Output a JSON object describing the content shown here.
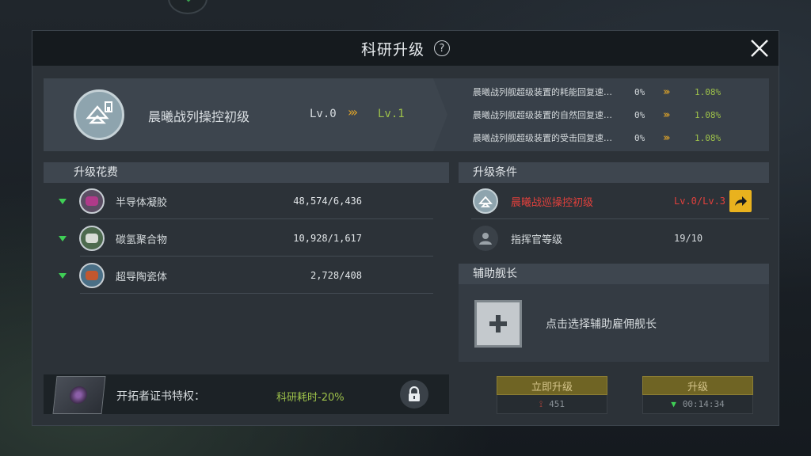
{
  "modal": {
    "title": "科研升级",
    "help_glyph": "?"
  },
  "research": {
    "name": "晨曦战列操控初级",
    "level_from": "Lv.0",
    "level_arrows": "›››",
    "level_to": "Lv.1",
    "stats": [
      {
        "name": "晨曦战列舰超级装置的耗能回复速…",
        "from": "0%",
        "to": "1.08%"
      },
      {
        "name": "晨曦战列舰超级装置的自然回复速…",
        "from": "0%",
        "to": "1.08%"
      },
      {
        "name": "晨曦战列舰超级装置的受击回复速…",
        "from": "0%",
        "to": "1.08%"
      }
    ]
  },
  "cost": {
    "header": "升级花费",
    "items": [
      {
        "name": "半导体凝胶",
        "count": "48,574/6,436",
        "color": "#b03a8a"
      },
      {
        "name": "碳氢聚合物",
        "count": "10,928/1,617",
        "color": "#6aa15a"
      },
      {
        "name": "超导陶瓷体",
        "count": "2,728/408",
        "color": "#c2572f"
      }
    ]
  },
  "privilege": {
    "label": "开拓者证书特权：",
    "value": "科研耗时-20%"
  },
  "conditions": {
    "header": "升级条件",
    "items": [
      {
        "name": "晨曦战巡操控初级",
        "value": "Lv.0/Lv.3",
        "status_color": "#e0403c"
      },
      {
        "name": "指挥官等级",
        "value": "19/10",
        "status_color": "#d5dadd"
      }
    ]
  },
  "assistant": {
    "header": "辅助舰长",
    "prompt": "点击选择辅助雇佣舰长"
  },
  "buttons": {
    "instant": {
      "label": "立即升级",
      "cost": "451"
    },
    "upgrade": {
      "label": "升级",
      "time": "00:14:34"
    }
  }
}
